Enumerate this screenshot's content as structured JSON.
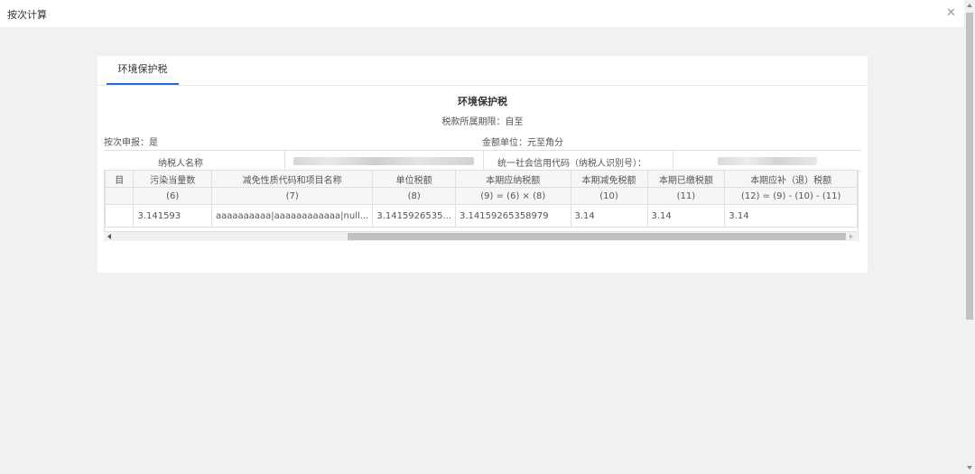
{
  "dialog": {
    "title": "按次计算",
    "close_icon": "close-icon"
  },
  "tabs": [
    {
      "label": "环境保护税",
      "active": true
    }
  ],
  "form": {
    "title": "环境保护税",
    "period_label": "税款所属期限：自至",
    "per_filing_label": "按次申报：是",
    "amount_unit_label": "金额单位：元至角分",
    "taxpayer_name_label": "纳税人名称",
    "credit_code_label": "统一社会信用代码（纳税人识别号）："
  },
  "table": {
    "headers": [
      "目",
      "污染当量数",
      "减免性质代码和项目名称",
      "单位税额",
      "本期应纳税额",
      "本期减免税额",
      "本期已缴税额",
      "本期应补（退）税额"
    ],
    "index_row": [
      "",
      "(6)",
      "(7)",
      "(8)",
      "(9) = (6) × (8)",
      "(10)",
      "(11)",
      "(12) = (9) - (10) - (11)"
    ],
    "rows": [
      [
        "",
        "3.141593",
        "aaaaaaaaaa|aaaaaaaaaaaa|null...",
        "3.1415926535...",
        "3.14159265358979",
        "3.14",
        "3.14",
        "3.14"
      ]
    ]
  },
  "colors": {
    "accent": "#1e6fd9",
    "background": "#f1f1f1",
    "header_bg": "#f5f6f8"
  }
}
